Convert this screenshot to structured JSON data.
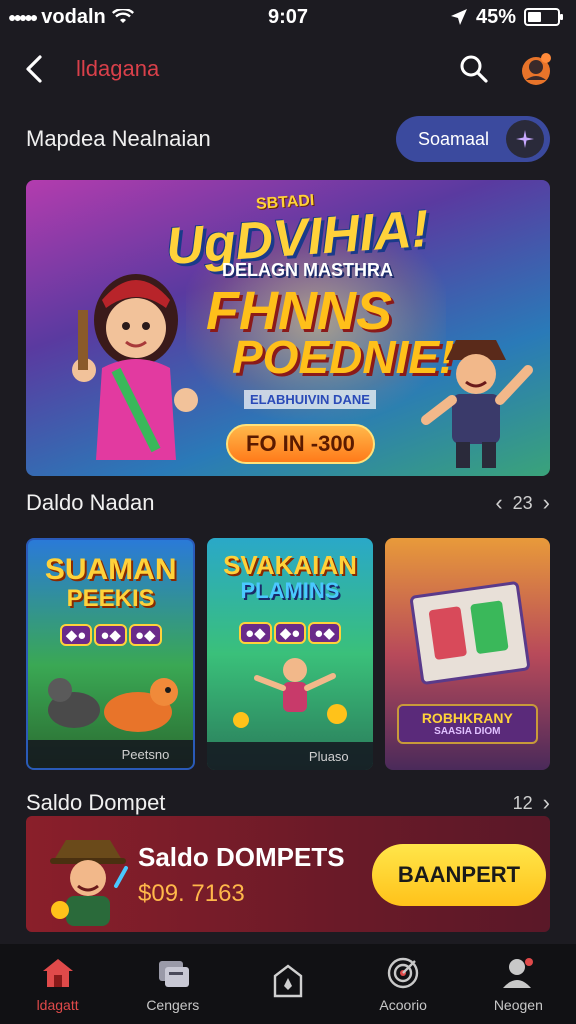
{
  "status_bar": {
    "carrier": "vodaln",
    "time": "9:07",
    "battery_text": "45%",
    "battery_level": 0.45
  },
  "header": {
    "title": "lldagana",
    "title_color": "#d9404a"
  },
  "featured": {
    "section_title": "Mapdea Nealnaian",
    "pill_label": "Soamaal"
  },
  "hero": {
    "tag": "SBTADI",
    "title_line_1": "UgDVIHIA!",
    "subtitle": "DELAGN MASTHRA",
    "title_line_2": "FHNNS",
    "title_line_3": "POEDNIE!",
    "strip": "ELABHUIVIN DANE",
    "cta_label": "FO IN -300"
  },
  "games": {
    "section_title": "Daldo Nadan",
    "count": "23",
    "cards": [
      {
        "title_1": "SUAMAN",
        "title_2": "PEEKIS",
        "footer": "Peetsno"
      },
      {
        "title_1": "SVAKAIAN",
        "title_2": "PLAMINS",
        "footer": "Pluaso"
      },
      {
        "label": "ROBHKRANY",
        "sublabel": "SAASIA DIOM"
      }
    ]
  },
  "wallet": {
    "section_title": "Saldo Dompet",
    "count": "12",
    "title": "Saldo DOMPETS",
    "amount": "$09. 7163",
    "button_label": "BAANPERT"
  },
  "bottom_nav": {
    "items": [
      {
        "label": "ldagatt",
        "icon": "home-icon"
      },
      {
        "label": "Cengers",
        "icon": "games-icon"
      },
      {
        "label": "",
        "icon": "wallet-icon"
      },
      {
        "label": "Acoorio",
        "icon": "target-icon"
      },
      {
        "label": "Neogen",
        "icon": "profile-icon"
      }
    ],
    "active_color": "#e04a4a"
  }
}
